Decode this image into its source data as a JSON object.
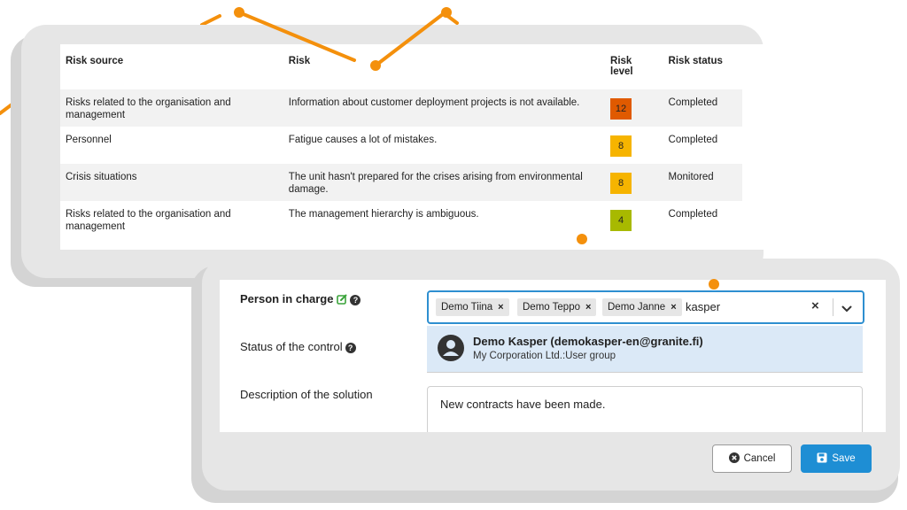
{
  "colors": {
    "accent_orange": "#f4900c",
    "primary_blue": "#1e8ed4",
    "focus_blue": "#2e8fd0",
    "highlight_blue": "#dbe9f7",
    "level_high": "#e05a00",
    "level_medium": "#f6b400",
    "level_low": "#a8b900"
  },
  "risk_table": {
    "headers": {
      "source": "Risk source",
      "risk": "Risk",
      "level": "Risk level",
      "status": "Risk status"
    },
    "rows": [
      {
        "source": "Risks related to the organisation and management",
        "risk": "Information about customer deployment projects is not available.",
        "level": "12",
        "level_color": "#e05a00",
        "status": "Completed"
      },
      {
        "source": "Personnel",
        "risk": "Fatigue causes a lot of mistakes.",
        "level": "8",
        "level_color": "#f6b400",
        "status": "Completed"
      },
      {
        "source": "Crisis situations",
        "risk": "The unit hasn't prepared for the crises arising from environmental damage.",
        "level": "8",
        "level_color": "#f6b400",
        "status": "Monitored"
      },
      {
        "source": "Risks related to the organisation and management",
        "risk": "The management hierarchy is ambiguous.",
        "level": "4",
        "level_color": "#a8b900",
        "status": "Completed"
      }
    ]
  },
  "control_form": {
    "person_in_charge_label": "Person in charge",
    "selected_people": [
      "Demo Tiina",
      "Demo Teppo",
      "Demo Janne"
    ],
    "remove_symbol": "×",
    "search_query": "kasper",
    "clear_symbol": "×",
    "status_label": "Status of the control",
    "suggestion": {
      "name": "Demo Kasper (demokasper-en@granite.fi)",
      "group": "My Corporation Ltd.:User group"
    },
    "description_label": "Description of the solution",
    "description_value": "New contracts have been made."
  },
  "buttons": {
    "cancel": "Cancel",
    "save": "Save"
  },
  "icons": {
    "help": "?",
    "edit": "edit-icon",
    "avatar": "user-avatar-icon",
    "chevron": "chevron-down-icon",
    "cancel": "cancel-circle-icon",
    "save": "floppy-disk-icon"
  }
}
